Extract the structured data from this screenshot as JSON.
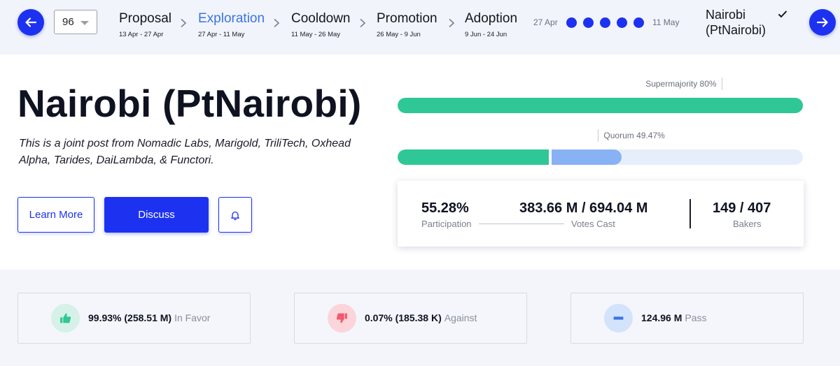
{
  "header": {
    "period_select": {
      "value": "96"
    },
    "periods": [
      {
        "name": "Proposal",
        "dates": "13 Apr - 27 Apr",
        "active": false
      },
      {
        "name": "Exploration",
        "dates": "27 Apr - 11 May",
        "active": true
      },
      {
        "name": "Cooldown",
        "dates": "11 May - 26 May",
        "active": false
      },
      {
        "name": "Promotion",
        "dates": "26 May - 9 Jun",
        "active": false
      },
      {
        "name": "Adoption",
        "dates": "9 Jun - 24 Jun",
        "active": false
      }
    ],
    "timeline": {
      "start": "27 Apr",
      "end": "11 May",
      "dot_count": 5
    },
    "proposal_name_line1": "Nairobi",
    "proposal_name_line2": "(PtNairobi)",
    "icons": {
      "prev": "arrow-left-icon",
      "next": "arrow-right-icon",
      "check": "check-icon",
      "chevron": "chevron-right-icon"
    }
  },
  "main": {
    "title": "Nairobi (PtNairobi)",
    "description": "This is a joint post from Nomadic Labs, Marigold, TriliTech, Oxhead Alpha, Tarides, DaiLambda, & Functori.",
    "learn_more_label": "Learn More",
    "discuss_label": "Discuss",
    "bell_icon": "bell-icon"
  },
  "supermajority": {
    "label": "Supermajority 80%",
    "threshold_pct": 80,
    "yay_pct": 99.93,
    "nay_pct": 0.07
  },
  "quorum": {
    "label": "Quorum 49.47%",
    "threshold_pct": 49.47,
    "yay_nay_pct": 37.26,
    "pass_pct": 18.02
  },
  "stats": {
    "participation_value": "55.28%",
    "participation_label": "Participation",
    "votes_cast_value": "383.66 M / 694.04 M",
    "votes_cast_label": "Votes Cast",
    "bakers_value": "149 / 407",
    "bakers_label": "Bakers"
  },
  "votes": [
    {
      "value": "99.93% (258.51 M)",
      "label": "In Favor",
      "icon": "thumbs-up-icon"
    },
    {
      "value": "0.07% (185.38 K)",
      "label": "Against",
      "icon": "thumbs-down-icon"
    },
    {
      "value": "124.96 M",
      "label": "Pass",
      "icon": "minus-icon"
    }
  ],
  "colors": {
    "accent": "#1d32f0",
    "active_period": "#3a73e6",
    "yay": "#2fc795",
    "nay": "#f3596e",
    "pass": "#89b2f5",
    "track": "#e6eefb"
  }
}
